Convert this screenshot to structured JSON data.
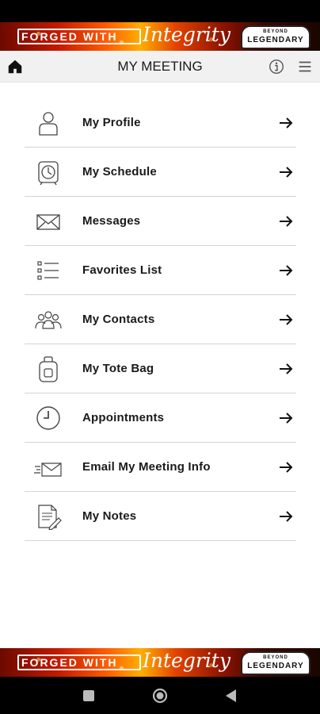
{
  "banner": {
    "forged_text": "FORGED WITH",
    "integrity_text": "Integrity",
    "badge_top": "BEYOND",
    "badge_bottom": "LEGENDARY"
  },
  "header": {
    "title": "MY MEETING",
    "icons": {
      "home": "home-icon",
      "info": "info-icon",
      "menu": "hamburger-menu-icon"
    }
  },
  "menu": {
    "items": [
      {
        "label": "My Profile",
        "icon": "person-icon"
      },
      {
        "label": "My Schedule",
        "icon": "alarm-clock-icon"
      },
      {
        "label": "Messages",
        "icon": "envelope-icon"
      },
      {
        "label": "Favorites List",
        "icon": "checklist-icon"
      },
      {
        "label": "My Contacts",
        "icon": "group-icon"
      },
      {
        "label": "My Tote Bag",
        "icon": "bag-icon"
      },
      {
        "label": "Appointments",
        "icon": "clock-icon"
      },
      {
        "label": "Email My Meeting Info",
        "icon": "email-send-icon"
      },
      {
        "label": "My Notes",
        "icon": "notes-icon"
      }
    ],
    "arrow_icon": "arrow-right-icon"
  },
  "navbar": {
    "icons": [
      "recents-square-icon",
      "home-circle-icon",
      "back-triangle-icon"
    ]
  },
  "colors": {
    "header_bg": "#f1f1f1",
    "divider": "#d4d4d4",
    "text": "#1a1a1a"
  }
}
